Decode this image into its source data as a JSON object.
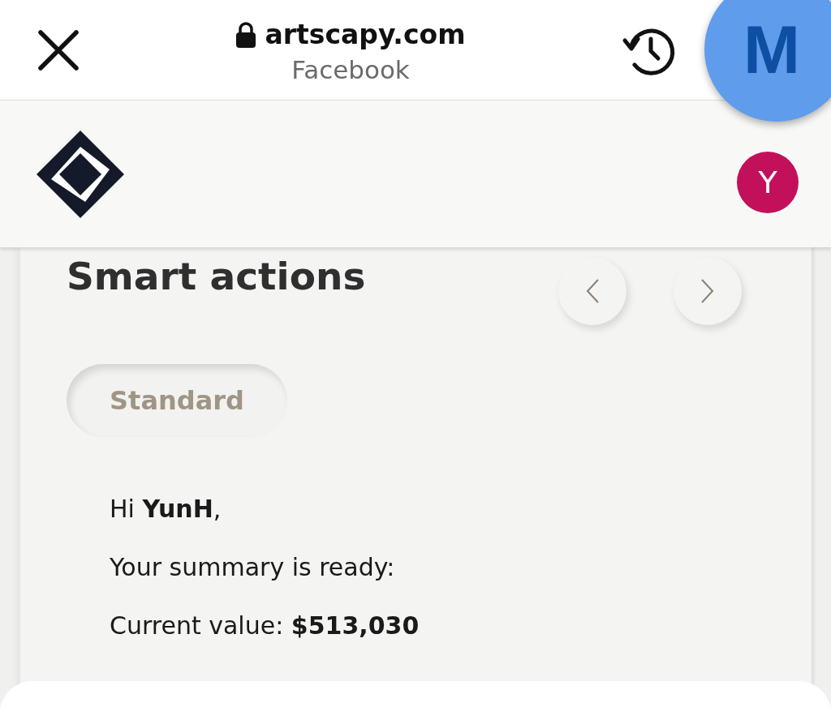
{
  "browser_bar": {
    "domain": "artscapy.com",
    "subtitle": "Facebook"
  },
  "chat_bubble": {
    "letter": "M"
  },
  "site_header": {
    "avatar": "Y"
  },
  "smart_actions": {
    "title": "Smart actions",
    "chip": {
      "label": "Standard",
      "selected": true
    },
    "lines": [
      "Hi **YunH**,",
      "Your summary is ready:",
      "Current value: **$513,030**"
    ]
  }
}
